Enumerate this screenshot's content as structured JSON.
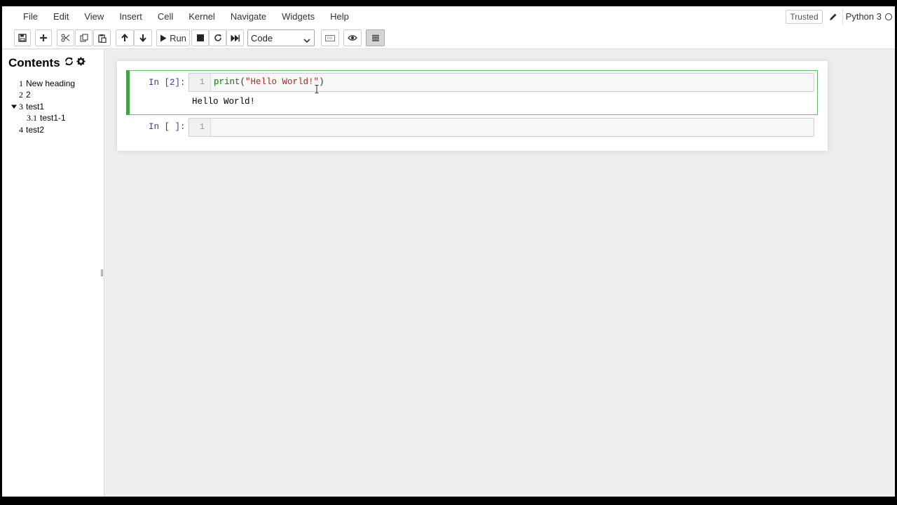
{
  "menubar": {
    "items": [
      "File",
      "Edit",
      "View",
      "Insert",
      "Cell",
      "Kernel",
      "Navigate",
      "Widgets",
      "Help"
    ],
    "trusted_label": "Trusted",
    "kernel_name": "Python 3"
  },
  "toolbar": {
    "run_label": "Run",
    "cell_type": "Code",
    "icons": [
      "save-icon",
      "plus-icon",
      "cut-icon",
      "copy-icon",
      "paste-icon",
      "arrow-up-icon",
      "arrow-down-icon",
      "play-icon",
      "stop-icon",
      "restart-icon",
      "fast-forward-icon",
      "keyboard-icon",
      "eye-icon",
      "list-icon"
    ]
  },
  "sidebar": {
    "title": "Contents",
    "items": [
      {
        "num": "1",
        "label": "New heading"
      },
      {
        "num": "2",
        "label": "2"
      },
      {
        "num": "3",
        "label": "test1",
        "expanded": true
      },
      {
        "num": "3.1",
        "label": "test1-1"
      },
      {
        "num": "4",
        "label": "test2"
      }
    ]
  },
  "cells": [
    {
      "prompt": "In [2]:",
      "line_number": "1",
      "code": {
        "fn": "print",
        "open": "(",
        "string": "\"Hello World!\"",
        "close": ")"
      },
      "output": "Hello World!"
    },
    {
      "prompt": "In [ ]:",
      "line_number": "1"
    }
  ]
}
